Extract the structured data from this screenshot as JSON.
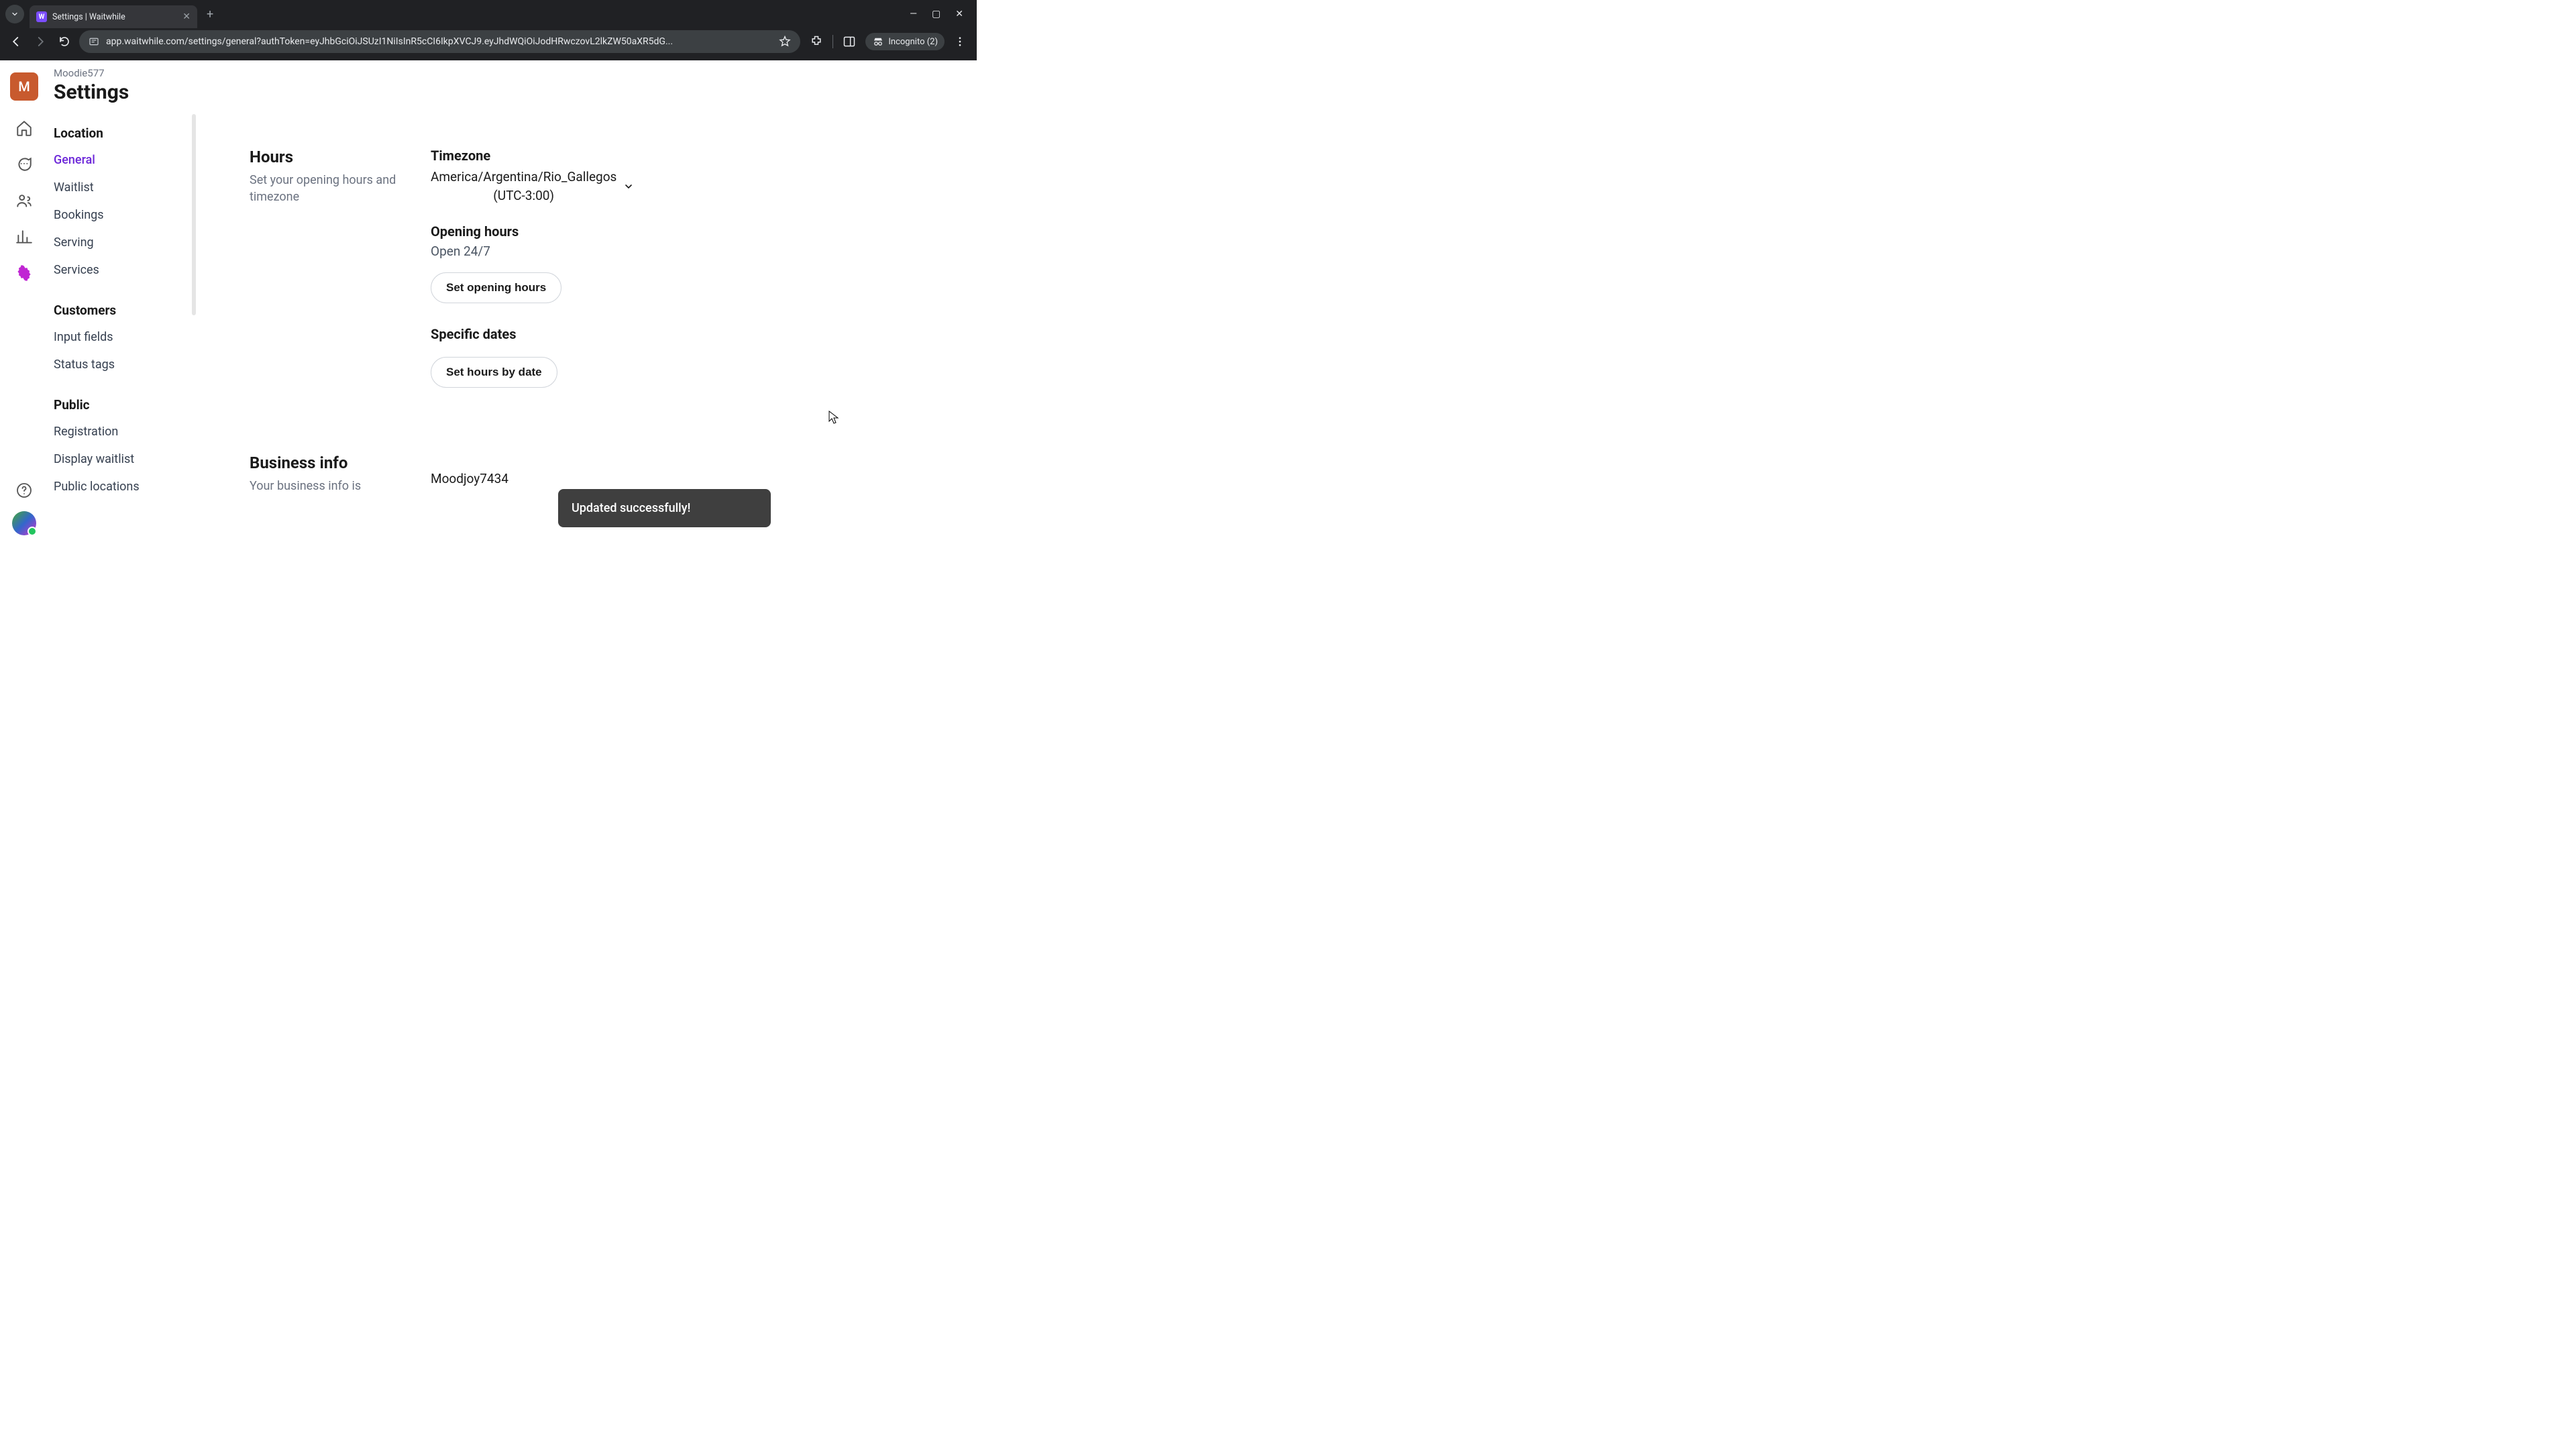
{
  "browser": {
    "tab_title": "Settings | Waitwhile",
    "url": "app.waitwhile.com/settings/general?authToken=eyJhbGciOiJSUzI1NiIsInR5cCI6IkpXVCJ9.eyJhdWQiOiJodHRwczovL2lkZW50aXR5dG...",
    "incognito_label": "Incognito (2)"
  },
  "header": {
    "org": "Moodie577",
    "avatar_initial": "M",
    "page_title": "Settings"
  },
  "sidebar": {
    "sections": [
      {
        "title": "Location",
        "items": [
          "General",
          "Waitlist",
          "Bookings",
          "Serving",
          "Services"
        ],
        "active_index": 0
      },
      {
        "title": "Customers",
        "items": [
          "Input fields",
          "Status tags"
        ],
        "active_index": -1
      },
      {
        "title": "Public",
        "items": [
          "Registration",
          "Display waitlist",
          "Public locations"
        ],
        "active_index": -1
      }
    ]
  },
  "hours": {
    "title": "Hours",
    "desc": "Set your opening hours and timezone",
    "timezone_label": "Timezone",
    "timezone_value_line1": "America/Argentina/Rio_Gallegos",
    "timezone_value_line2": "(UTC-3:00)",
    "opening_label": "Opening hours",
    "opening_value": "Open 24/7",
    "set_opening_btn": "Set opening hours",
    "specific_label": "Specific dates",
    "set_by_date_btn": "Set hours by date"
  },
  "business": {
    "title": "Business info",
    "desc": "Your business info is",
    "name_value": "Moodjoy7434"
  },
  "toast": {
    "message": "Updated successfully!"
  }
}
